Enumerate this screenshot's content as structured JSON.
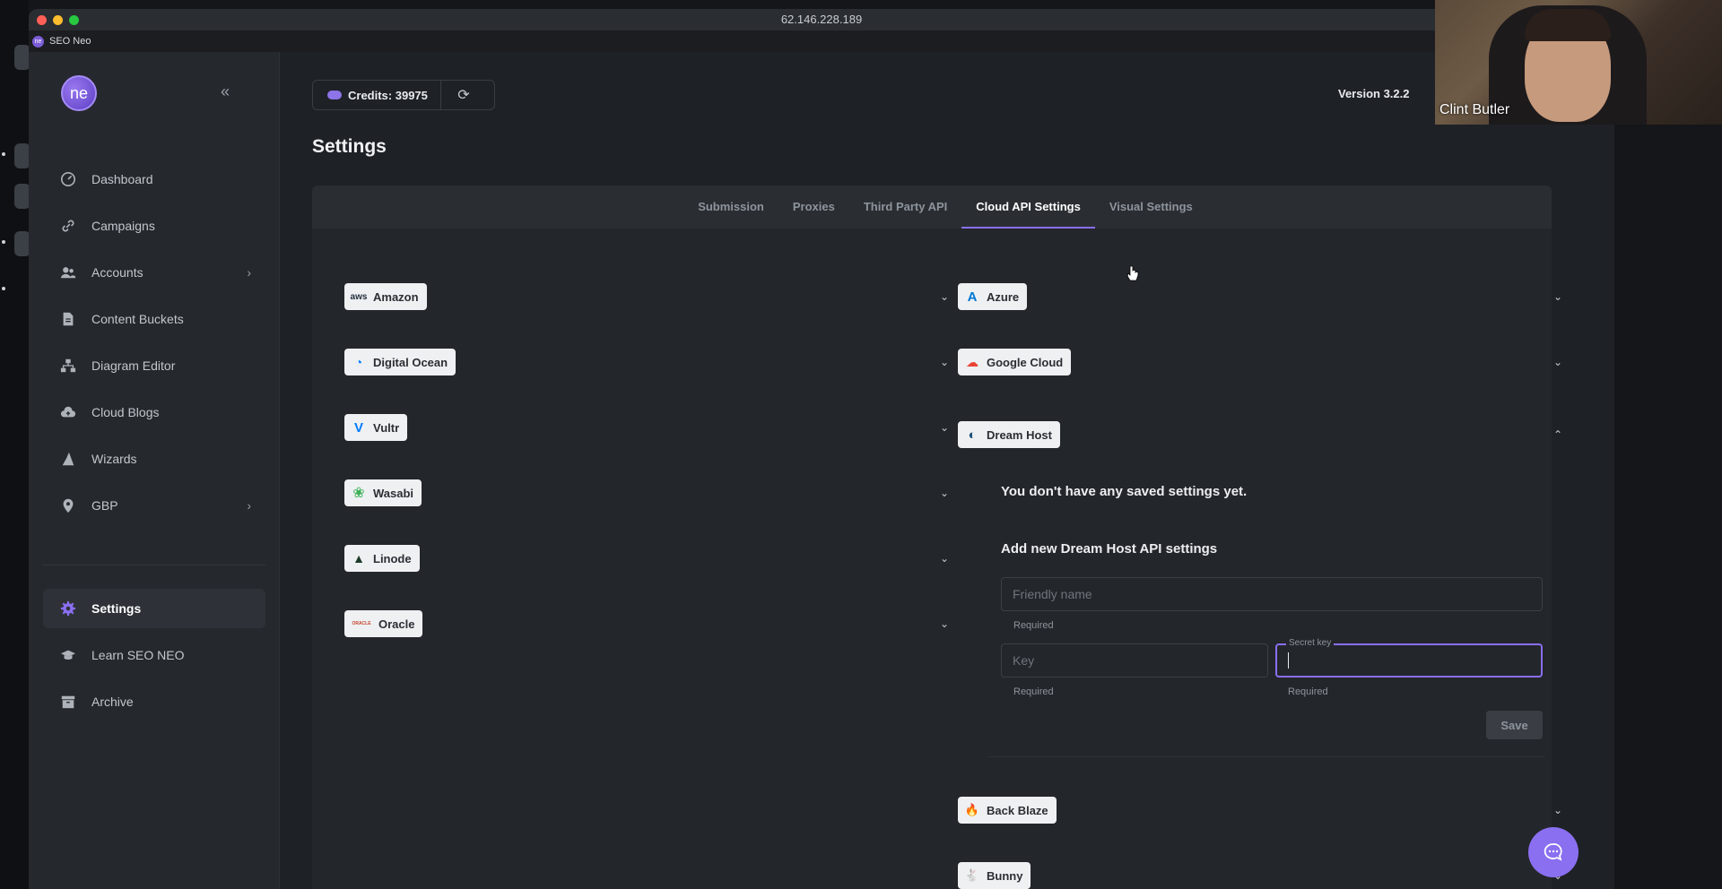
{
  "window": {
    "address": "62.146.228.189",
    "app_title": "SEO Neo",
    "logo_text": "ne"
  },
  "sidebar": {
    "items": [
      {
        "label": "Dashboard",
        "icon": "dashboard-icon"
      },
      {
        "label": "Campaigns",
        "icon": "link-icon"
      },
      {
        "label": "Accounts",
        "icon": "users-icon",
        "has_children": true
      },
      {
        "label": "Content Buckets",
        "icon": "document-icon"
      },
      {
        "label": "Diagram Editor",
        "icon": "diagram-icon"
      },
      {
        "label": "Cloud Blogs",
        "icon": "cloud-upload-icon"
      },
      {
        "label": "Wizards",
        "icon": "wizard-hat-icon"
      },
      {
        "label": "GBP",
        "icon": "location-pin-icon",
        "has_children": true
      }
    ],
    "bottom_items": [
      {
        "label": "Settings",
        "icon": "gear-icon",
        "active": true
      },
      {
        "label": "Learn SEO NEO",
        "icon": "graduation-cap-icon"
      },
      {
        "label": "Archive",
        "icon": "archive-icon"
      }
    ]
  },
  "header": {
    "credits_label": "Credits: 39975",
    "version": "Version 3.2.2"
  },
  "page": {
    "title": "Settings",
    "tabs": [
      {
        "label": "Submission"
      },
      {
        "label": "Proxies"
      },
      {
        "label": "Third Party API"
      },
      {
        "label": "Cloud API Settings",
        "active": true
      },
      {
        "label": "Visual Settings"
      }
    ]
  },
  "providers_left": [
    {
      "label": "Amazon",
      "icon_text": "aws",
      "color": "#232f3e"
    },
    {
      "label": "Digital Ocean",
      "icon_text": "◔",
      "color": "#0080ff"
    },
    {
      "label": "Vultr",
      "icon_text": "V",
      "color": "#007bfc"
    },
    {
      "label": "Wasabi",
      "icon_text": "❀",
      "color": "#3db157"
    },
    {
      "label": "Linode",
      "icon_text": "▲",
      "color": "#1d3c2a"
    },
    {
      "label": "Oracle",
      "icon_text": "ORACLE",
      "color": "#c74634"
    }
  ],
  "providers_right": [
    {
      "label": "Azure",
      "icon_text": "A",
      "color": "#0078d4"
    },
    {
      "label": "Google Cloud",
      "icon_text": "☁",
      "color": "#ea4335"
    },
    {
      "label": "Dream Host",
      "icon_text": "◐",
      "color": "#1f4e79",
      "expanded": true
    },
    {
      "label": "Back Blaze",
      "icon_text": "🔥",
      "color": "#e21e29"
    },
    {
      "label": "Bunny",
      "icon_text": "🐇",
      "color": "#f78c2e"
    }
  ],
  "dream_host": {
    "empty_message": "You don't have any saved settings yet.",
    "add_title": "Add new Dream Host API settings",
    "friendly_name_placeholder": "Friendly name",
    "key_placeholder": "Key",
    "secret_key_label": "Secret key",
    "required_text": "Required",
    "save_label": "Save"
  },
  "webcam": {
    "name": "Clint Butler"
  },
  "colors": {
    "accent": "#8a6ff0",
    "sidebar_bg": "#25282d",
    "main_bg": "#1e2126"
  }
}
